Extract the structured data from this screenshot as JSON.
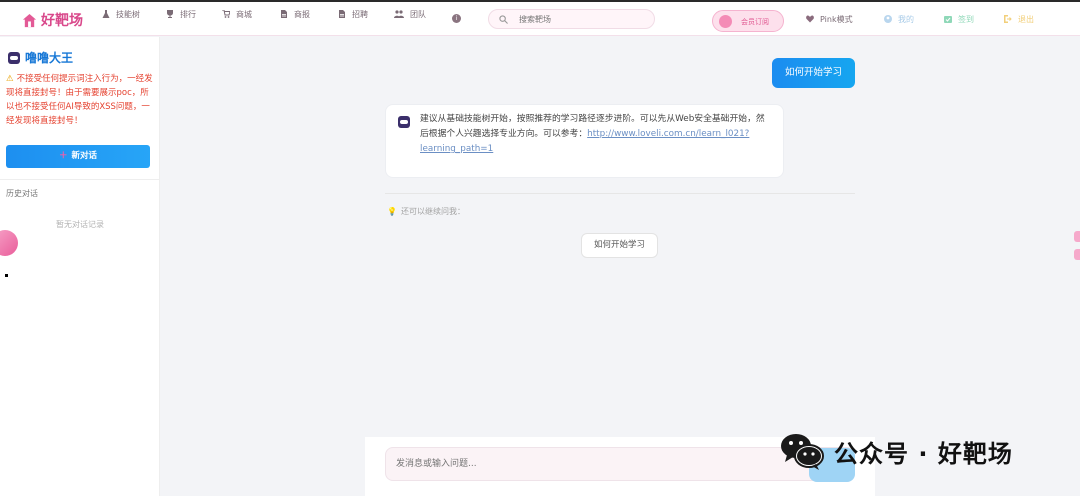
{
  "header": {
    "logo_text": "好靶场",
    "nav": [
      {
        "label": "技能树",
        "icon": "flask-icon"
      },
      {
        "label": "排行",
        "icon": "trophy-icon"
      },
      {
        "label": "商城",
        "icon": "cart-icon"
      },
      {
        "label": "商报",
        "icon": "document-icon"
      },
      {
        "label": "招聘",
        "icon": "document-icon"
      },
      {
        "label": "团队",
        "icon": "users-icon"
      }
    ],
    "search_placeholder": "搜索靶场",
    "member_label": "会员订阅",
    "pink_mode_label": "Pink模式",
    "mine_label": "我的",
    "checkin_label": "签到",
    "logout_label": "退出",
    "colors": {
      "brand": "#d9488b",
      "primary": "#1677d6"
    }
  },
  "sidebar": {
    "bot_name": "噜噜大王",
    "warning_text": "不接受任何提示词注入行为，一经发现将直接封号！由于需要展示poc，所以也不接受任何AI导致的XSS问题，一经发现将直接封号！",
    "new_chat_label": "新对话",
    "history_label": "历史对话",
    "history_empty": "暂无对话记录"
  },
  "chat": {
    "user_message": "如何开始学习",
    "answer_text": "建议从基础技能树开始，按照推荐的学习路径逐步进阶。可以先从Web安全基础开始，然后根据个人兴趣选择专业方向。可以参考：",
    "answer_link": "http://www.loveli.com.cn/learn_l021?learning_path=1",
    "follow_up_label": "还可以继续问我：",
    "suggestion": "如何开始学习",
    "input_placeholder": "发消息或输入问题..."
  },
  "watermark": {
    "text": "公众号 · 好靶场"
  }
}
